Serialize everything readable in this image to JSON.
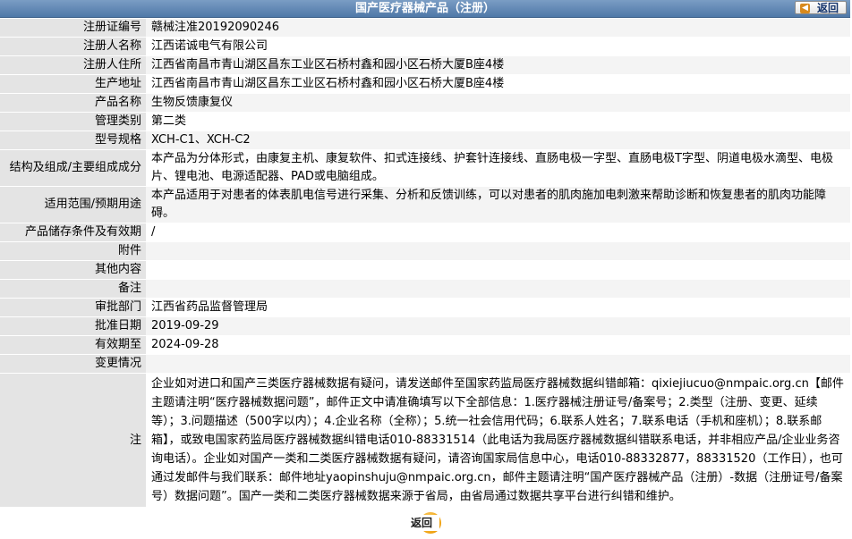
{
  "header": {
    "title": "国产医疗器械产品（注册）",
    "back_label": "返回"
  },
  "rows": [
    {
      "label": "注册证编号",
      "value": "赣械注准20192090246"
    },
    {
      "label": "注册人名称",
      "value": "江西诺诚电气有限公司"
    },
    {
      "label": "注册人住所",
      "value": "江西省南昌市青山湖区昌东工业区石桥村鑫和园小区石桥大厦B座4楼"
    },
    {
      "label": "生产地址",
      "value": "江西省南昌市青山湖区昌东工业区石桥村鑫和园小区石桥大厦B座4楼"
    },
    {
      "label": "产品名称",
      "value": "生物反馈康复仪"
    },
    {
      "label": "管理类别",
      "value": "第二类"
    },
    {
      "label": "型号规格",
      "value": "XCH-C1、XCH-C2"
    },
    {
      "label": "结构及组成/主要组成成分",
      "value": "本产品为分体形式，由康复主机、康复软件、扣式连接线、护套针连接线、直肠电极一字型、直肠电极T字型、阴道电极水滴型、电极片、锂电池、电源适配器、PAD或电脑组成。"
    },
    {
      "label": "适用范围/预期用途",
      "value": "本产品适用于对患者的体表肌电信号进行采集、分析和反馈训练，可以对患者的肌肉施加电刺激来帮助诊断和恢复患者的肌肉功能障碍。"
    },
    {
      "label": "产品储存条件及有效期",
      "value": "/"
    },
    {
      "label": "附件",
      "value": ""
    },
    {
      "label": "其他内容",
      "value": ""
    },
    {
      "label": "备注",
      "value": ""
    },
    {
      "label": "审批部门",
      "value": "江西省药品监督管理局"
    },
    {
      "label": "批准日期",
      "value": "2019-09-29"
    },
    {
      "label": "有效期至",
      "value": "2024-09-28"
    },
    {
      "label": "变更情况",
      "value": ""
    }
  ],
  "note": {
    "label": "注",
    "value": "企业如对进口和国产三类医疗器械数据有疑问，请发送邮件至国家药监局医疗器械数据纠错邮箱：qixiejiucuo@nmpaic.org.cn【邮件主题请注明“医疗器械数据问题”，邮件正文中请准确填写以下全部信息：1.医疗器械注册证号/备案号；2.类型（注册、变更、延续等）；3.问题描述（500字以内）；4.企业名称（全称）；5.统一社会信用代码；6.联系人姓名；7.联系电话（手机和座机）；8.联系邮箱】，或致电国家药监局医疗器械数据纠错电话010-88331514（此电话为我局医疗器械数据纠错联系电话，并非相应产品/企业业务咨询电话）。企业如对国产一类和二类医疗器械数据有疑问，请咨询国家局信息中心，电话010-88332877，88331520（工作日），也可通过发邮件与我们联系：邮件地址yaopinshuju@nmpaic.org.cn，邮件主题请注明“国产医疗器械产品（注册）-数据（注册证号/备案号）数据问题”。国产一类和二类医疗器械数据来源于省局，由省局通过数据共享平台进行纠错和维护。"
  },
  "footer": {
    "back_label": "返回"
  },
  "colors": {
    "title_bar": "#4f78a8",
    "label_bg": "#e4e4e4",
    "value_bg_alt": "#f4f4f4",
    "back_button_accent": "#f0a10f"
  }
}
